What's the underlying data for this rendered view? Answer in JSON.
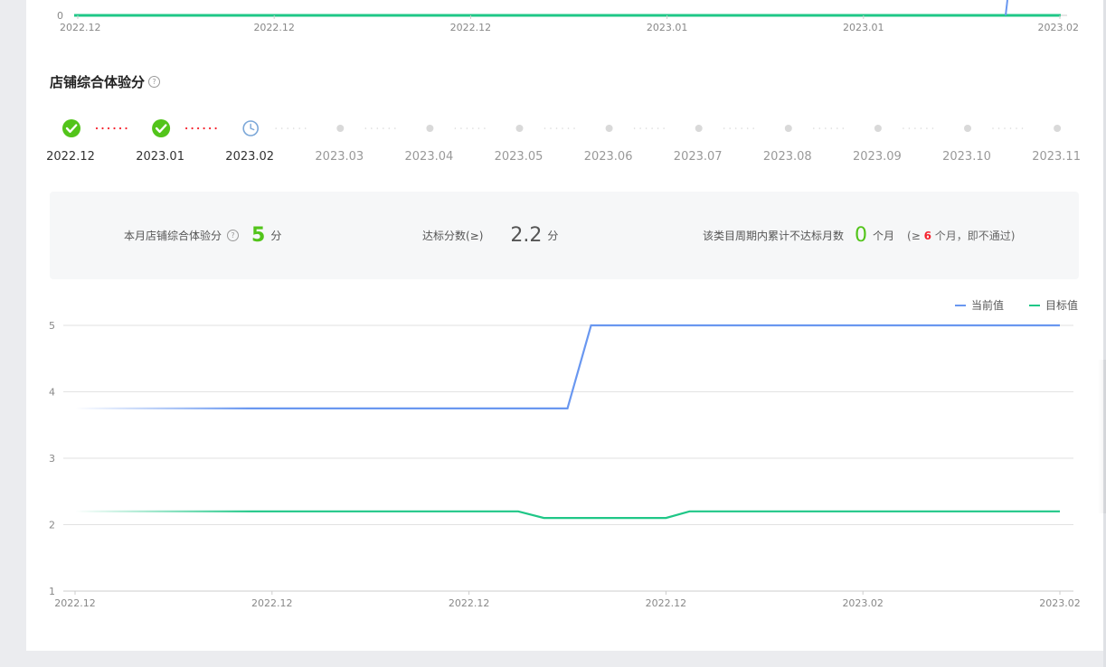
{
  "top_chart": {
    "y_label": "0",
    "x_ticks": [
      "2022.12",
      "2022.12",
      "2022.12",
      "2023.01",
      "2023.01",
      "2023.02"
    ],
    "colors": {
      "current": "#6997f0",
      "target": "#1fc787"
    }
  },
  "section": {
    "title": "店铺综合体验分"
  },
  "timeline": {
    "steps": [
      {
        "label": "2022.12",
        "status": "done"
      },
      {
        "label": "2023.01",
        "status": "done"
      },
      {
        "label": "2023.02",
        "status": "current"
      },
      {
        "label": "2023.03",
        "status": "pending"
      },
      {
        "label": "2023.04",
        "status": "pending"
      },
      {
        "label": "2023.05",
        "status": "pending"
      },
      {
        "label": "2023.06",
        "status": "pending"
      },
      {
        "label": "2023.07",
        "status": "pending"
      },
      {
        "label": "2023.08",
        "status": "pending"
      },
      {
        "label": "2023.09",
        "status": "pending"
      },
      {
        "label": "2023.10",
        "status": "pending"
      },
      {
        "label": "2023.11",
        "status": "pending"
      }
    ],
    "colors": {
      "done": "#52c41a",
      "current": "#7ba7d8",
      "pending": "#d9d9d9",
      "done_connector": "#f5222d"
    }
  },
  "summary": {
    "monthly_label": "本月店铺综合体验分",
    "monthly_value": "5",
    "monthly_unit": "分",
    "standard_label": "达标分数(≥)",
    "standard_value": "2.2",
    "standard_unit": "分",
    "fail_label": "该类目周期内累计不达标月数",
    "fail_value": "0",
    "fail_unit": "个月",
    "note_prefix": "(≥",
    "note_value": "6",
    "note_suffix": "个月，即不通过)"
  },
  "legend": {
    "current": "当前值",
    "target": "目标值"
  },
  "chart_data": {
    "type": "line",
    "x_ticks": [
      "2022.12",
      "2022.12",
      "2022.12",
      "2022.12",
      "2023.02",
      "2023.02"
    ],
    "ylim": [
      1,
      5
    ],
    "y_ticks": [
      1,
      2,
      3,
      4,
      5
    ],
    "grid": true,
    "legend_position": "top-right",
    "series": [
      {
        "name": "当前值",
        "color": "#6997f0",
        "points": [
          [
            0,
            3.75
          ],
          [
            2.5,
            3.75
          ],
          [
            2.62,
            5.0
          ],
          [
            5,
            5.0
          ]
        ]
      },
      {
        "name": "目标值",
        "color": "#1fc787",
        "points": [
          [
            0,
            2.2
          ],
          [
            2.25,
            2.2
          ],
          [
            2.38,
            2.1
          ],
          [
            3.0,
            2.1
          ],
          [
            3.12,
            2.2
          ],
          [
            5,
            2.2
          ]
        ]
      }
    ]
  }
}
